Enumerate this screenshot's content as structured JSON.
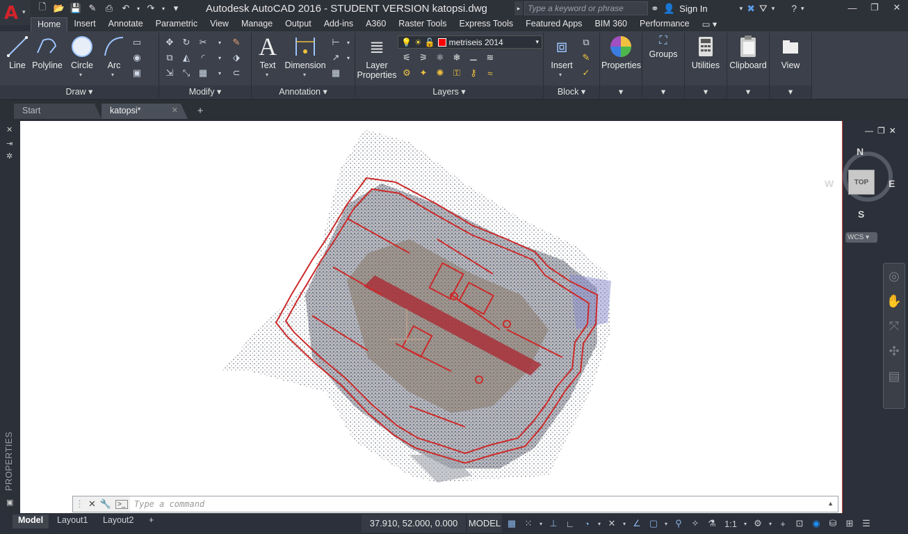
{
  "title": "Autodesk AutoCAD 2016 - STUDENT VERSION    katopsi.dwg",
  "search": {
    "placeholder": "Type a keyword or phrase"
  },
  "signin": "Sign In",
  "ribbon_tabs": [
    "Home",
    "Insert",
    "Annotate",
    "Parametric",
    "View",
    "Manage",
    "Output",
    "Add-ins",
    "A360",
    "Raster Tools",
    "Express Tools",
    "Featured Apps",
    "BIM 360",
    "Performance"
  ],
  "draw": {
    "line": "Line",
    "polyline": "Polyline",
    "circle": "Circle",
    "arc": "Arc",
    "title": "Draw"
  },
  "modify": {
    "title": "Modify"
  },
  "annotation": {
    "text": "Text",
    "dimension": "Dimension",
    "title": "Annotation"
  },
  "layers": {
    "layer_properties": "Layer\nProperties",
    "current_layer": "metriseis 2014",
    "title": "Layers",
    "current_color": "#ff0000"
  },
  "block": {
    "insert": "Insert",
    "title": "Block"
  },
  "properties": {
    "label": "Properties"
  },
  "groups": {
    "label": "Groups"
  },
  "utilities": {
    "label": "Utilities"
  },
  "clipboard": {
    "label": "Clipboard"
  },
  "view": {
    "label": "View"
  },
  "file_tabs": {
    "start": "Start",
    "active": "katopsi*"
  },
  "left_panel": {
    "label": "PROPERTIES"
  },
  "viewcube": {
    "n": "N",
    "s": "S",
    "e": "E",
    "w": "W",
    "top": "TOP",
    "wcs": "WCS"
  },
  "command": {
    "placeholder": "Type a command"
  },
  "layout_tabs": {
    "model": "Model",
    "layout1": "Layout1",
    "layout2": "Layout2"
  },
  "status": {
    "coords": "37.910, 52.000, 0.000",
    "model": "MODEL",
    "scale": "1:1"
  },
  "colors": {
    "accent": "#d4232b",
    "outline": "#cc2a2a",
    "ribbon": "#3b404a"
  },
  "icons": {
    "line": "line-icon",
    "polyline": "polyline-icon",
    "circle": "circle-icon",
    "arc": "arc-icon",
    "text": "text-icon",
    "dimension": "dimension-icon",
    "layer": "layer-properties-icon",
    "insert": "insert-block-icon",
    "properties": "properties-color-wheel-icon",
    "groups": "groups-icon",
    "utilities": "calculator-icon",
    "clipboard": "clipboard-icon",
    "view": "view-icon"
  }
}
